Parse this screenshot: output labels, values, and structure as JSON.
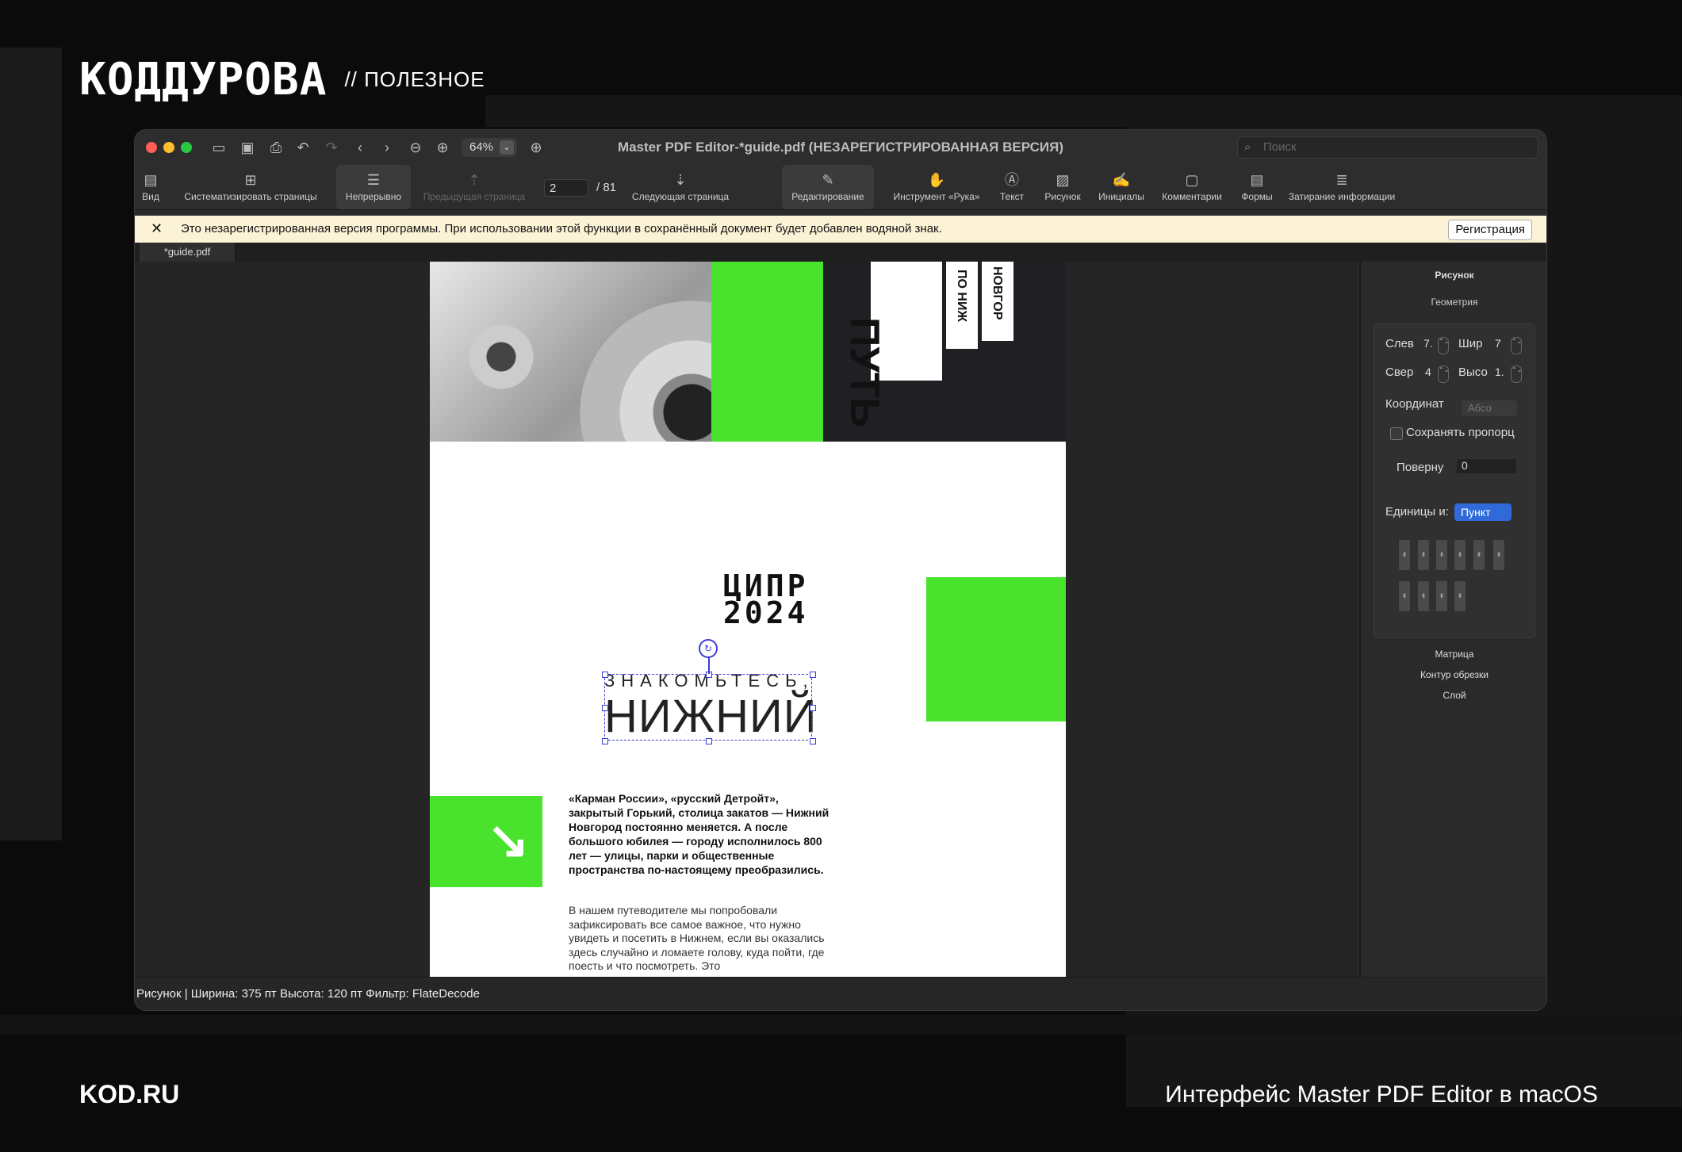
{
  "header": {
    "logo": "КОДДУРОВА",
    "section": "// ПОЛЕЗНОЕ"
  },
  "footer": {
    "site": "KOD.RU",
    "caption": "Интерфейс Master PDF Editor в macOS"
  },
  "window": {
    "title": "Master PDF Editor-*guide.pdf (НЕЗАРЕГИСТРИРОВАННАЯ ВЕРСИЯ)",
    "zoom": "64%",
    "search_placeholder": "Поиск"
  },
  "toolbar": {
    "view": "Вид",
    "organize": "Систематизировать страницы",
    "continuous": "Непрерывно",
    "prev_page": "Предыдущая страница",
    "page_current": "2",
    "page_total": "/ 81",
    "next_page": "Следующая страница",
    "edit": "Редактирование",
    "hand": "Инструмент «Рука»",
    "text": "Текст",
    "image": "Рисунок",
    "initials": "Инициалы",
    "comments": "Комментарии",
    "forms": "Формы",
    "redact": "Затирание информации"
  },
  "banner": {
    "message": "Это незарегистрированная версия программы. При использовании этой функции в сохранённый документ будет добавлен водяной знак.",
    "register": "Регистрация"
  },
  "tabs": [
    {
      "label": "*guide.pdf"
    }
  ],
  "document": {
    "vertical_title": "ПУТЬ",
    "vertical_sub1": "ПО НИЖ",
    "vertical_sub2": "НОВГОР",
    "cipr_line1": "ЦИПР",
    "cipr_line2": "2024",
    "heading_small": "ЗНАКОМЬТЕСЬ,",
    "heading_large": "НИЖНИЙ",
    "bold_paragraph": "«Карман России», «русский Детройт», закрытый Горький, столица закатов — Нижний Новгород постоянно меняется. А после большого юбилея — городу исполнилось 800 лет — улицы, парки и общественные пространства по-настоящему преобразились.",
    "paragraph": "В нашем путеводителе мы попробовали зафиксировать все самое важное, что нужно увидеть и посетить в Нижнем, если вы оказались здесь случайно и ломаете голову, куда пойти, где поесть и что посмотреть. Это",
    "accent_color": "#49e22d"
  },
  "panel": {
    "title": "Рисунок",
    "section": "Геометрия",
    "left_label": "Слев",
    "left_value": "7.",
    "width_label": "Шир",
    "width_value": "7",
    "top_label": "Свер",
    "top_value": "4",
    "height_label": "Высо",
    "height_value": "1.",
    "coords_label": "Координат",
    "coords_value": "Абсо",
    "keep_ratio": "Сохранять пропорц",
    "rotate_label": "Поверну",
    "rotate_value": "0",
    "units_label": "Единицы и:",
    "units_value": "Пункт",
    "matrix": "Матрица",
    "clip": "Контур обрезки",
    "layer": "Слой"
  },
  "status": "Рисунок | Ширина: 375 пт Высота: 120 пт Фильтр: FlateDecode"
}
